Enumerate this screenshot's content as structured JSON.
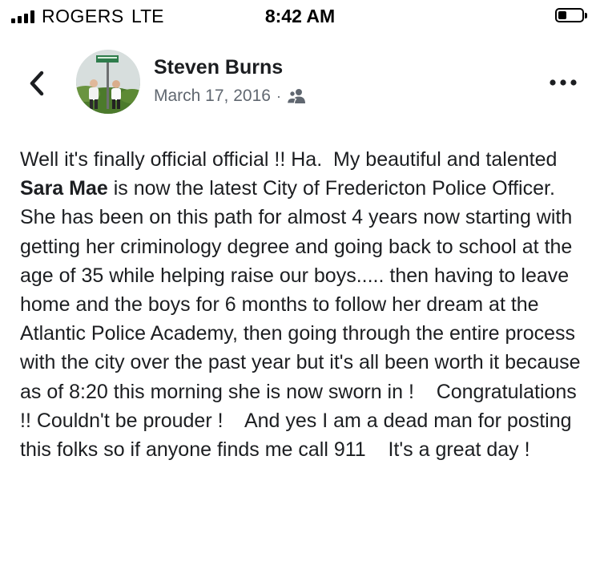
{
  "status_bar": {
    "carrier": "ROGERS",
    "network": "LTE",
    "time": "8:42 AM",
    "battery_level": 0.35
  },
  "header": {
    "author": "Steven Burns",
    "date": "March 17, 2016",
    "separator": "·",
    "audience_icon": "friends-icon",
    "back_icon": "chevron-left-icon",
    "more_icon": "more-horizontal-icon"
  },
  "post": {
    "segments": [
      "Well it's finally official official !! Ha.  My beautiful and talented ",
      "Sara Mae",
      " is now the latest City of Fredericton Police Officer.   She has been on this path for almost 4 years now starting with getting her criminology degree and going back to school at the age of 35 while helping raise our boys..... then having to leave home and the boys for 6 months to follow her dream at the Atlantic Police Academy, then going through the entire process with the city over the past year but it's all been worth it because as of 8:20 this morning she is now sworn in !    Congratulations !! Couldn't be prouder !    And yes I am a dead man for posting this folks so if anyone finds me call 911    It's a great day !"
    ]
  }
}
